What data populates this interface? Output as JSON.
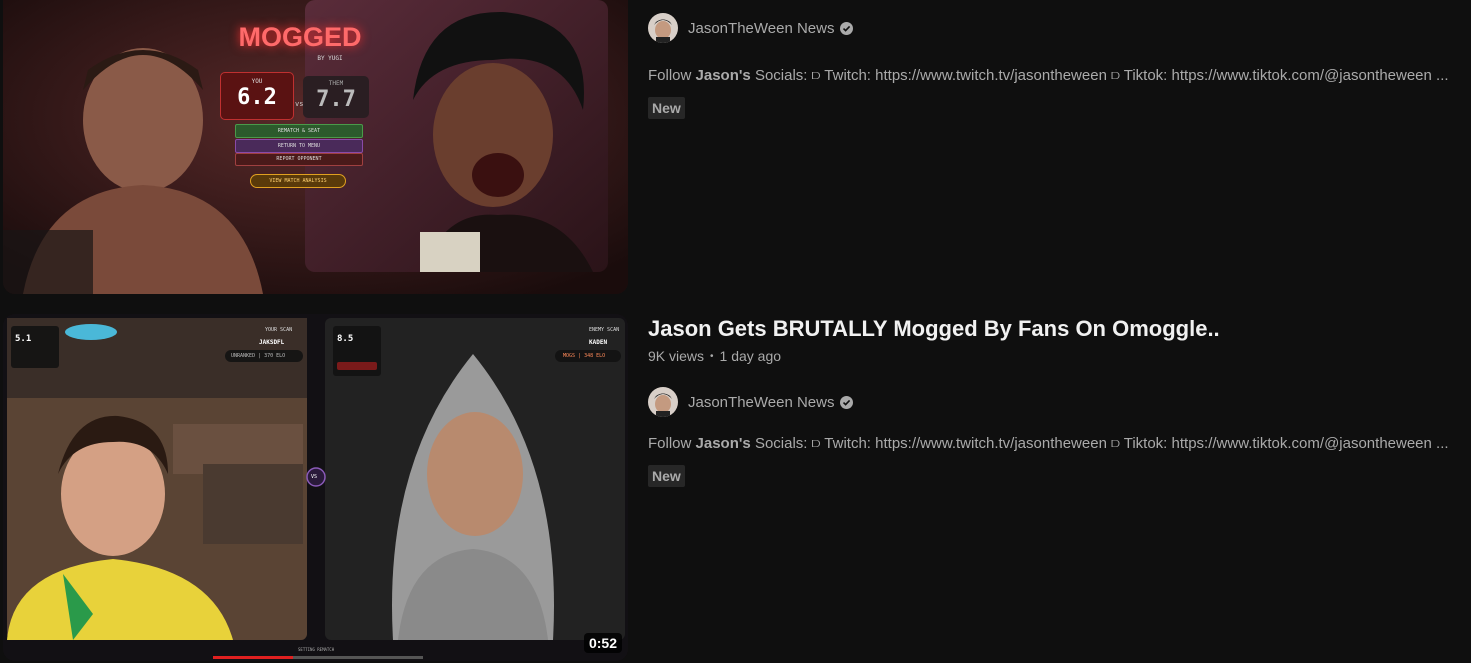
{
  "results": [
    {
      "title": "",
      "channel": "JasonTheWeen News",
      "description_prefix": "Follow ",
      "description_bold": "Jason's",
      "description_rest": " Socials: ⫐ Twitch: https://www.twitch.tv/jasontheween ⫐ Tiktok: https://www.tiktok.com/@jasontheween ...",
      "badge": "New",
      "thumbnail": {
        "overlay_title": "MOGGED",
        "overlay_sub": "BY YUGI",
        "score_you_label": "YOU",
        "score_you": "6.2",
        "score_vs": "vs",
        "score_them_label": "THEM",
        "score_them": "7.7",
        "buttons": [
          "REMATCH & SEAT",
          "RETURN TO MENU",
          "REPORT OPPONENT"
        ],
        "analysis_button": "VIEW MATCH ANALYSIS"
      }
    },
    {
      "title": "Jason Gets BRUTALLY Mogged By Fans On Omoggle..",
      "views": "9K views",
      "age": "1 day ago",
      "channel": "JasonTheWeen News",
      "description_prefix": "Follow ",
      "description_bold": "Jason's",
      "description_rest": " Socials: ⫐ Twitch: https://www.twitch.tv/jasontheween ⫐ Tiktok: https://www.tiktok.com/@jasontheween ...",
      "badge": "New",
      "duration": "0:52",
      "thumbnail": {
        "left_score": "5.1",
        "left_tag": "YOUR SCAN",
        "left_name": "JAKSDFL",
        "left_rank": "UNRANKED | 370 ELO",
        "right_score": "8.5",
        "right_tag": "ENEMY SCAN",
        "right_name": "KADEN",
        "right_rank": "MOGS | 348 ELO",
        "vs": "VS",
        "bottom_caption": "SETTING REMATCH"
      }
    }
  ],
  "colors": {
    "background": "#0f0f0f",
    "text_primary": "#f1f1f1",
    "text_secondary": "#aaaaaa",
    "badge_bg": "#272727",
    "mogged_red": "#ff5a5a",
    "progress_red": "#e02020"
  },
  "icons": {
    "verified": "verified-check-icon",
    "avatar": "channel-avatar"
  }
}
